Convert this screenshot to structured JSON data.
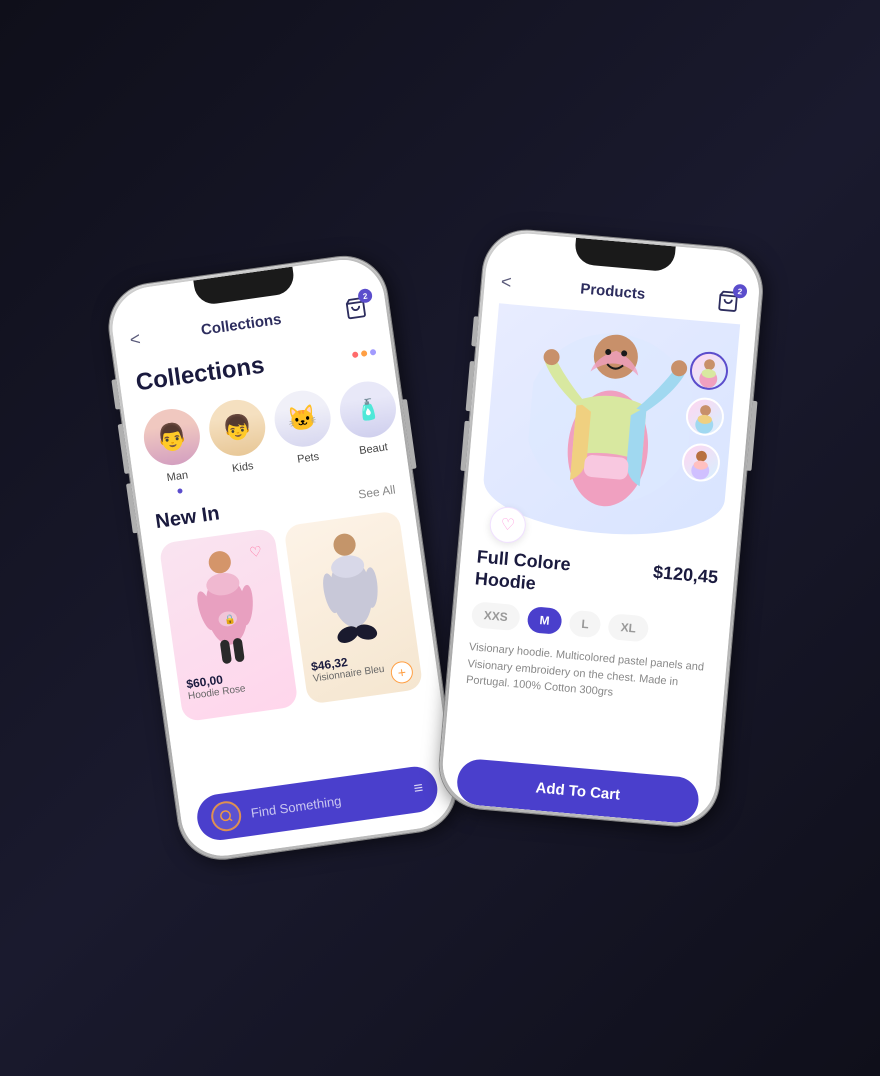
{
  "phone1": {
    "title": "Collections",
    "back_label": "<",
    "cart_badge": "2",
    "heading": "Collections",
    "categories": [
      {
        "label": "Man",
        "icon": "👨",
        "active": true
      },
      {
        "label": "Kids",
        "icon": "👦",
        "active": false
      },
      {
        "label": "Pets",
        "icon": "🐱",
        "active": false
      },
      {
        "label": "Beaut",
        "icon": "🧴",
        "active": false
      }
    ],
    "new_in_label": "New In",
    "see_all_label": "See All",
    "products": [
      {
        "price": "$60,00",
        "name": "Hoodie Rose",
        "color": "pink"
      },
      {
        "price": "$46,32",
        "name": "Visionnaire Bleu",
        "color": "blue"
      }
    ],
    "search_placeholder": "Find Something",
    "filter_icon": "≡"
  },
  "phone2": {
    "title": "Products",
    "back_label": "<",
    "cart_badge": "2",
    "product_name": "Full Colore\nHoodie",
    "product_price": "$120,45",
    "sizes": [
      "XXS",
      "M",
      "L",
      "XL"
    ],
    "active_size": "M",
    "description": "Visionary hoodie. Multicolored pastel panels and Visionary embroidery on the chest. Made in Portugal. 100% Cotton 300grs",
    "add_to_cart_label": "Add To Cart",
    "thumbnails": [
      "🧥",
      "🧥",
      "🧥"
    ]
  }
}
